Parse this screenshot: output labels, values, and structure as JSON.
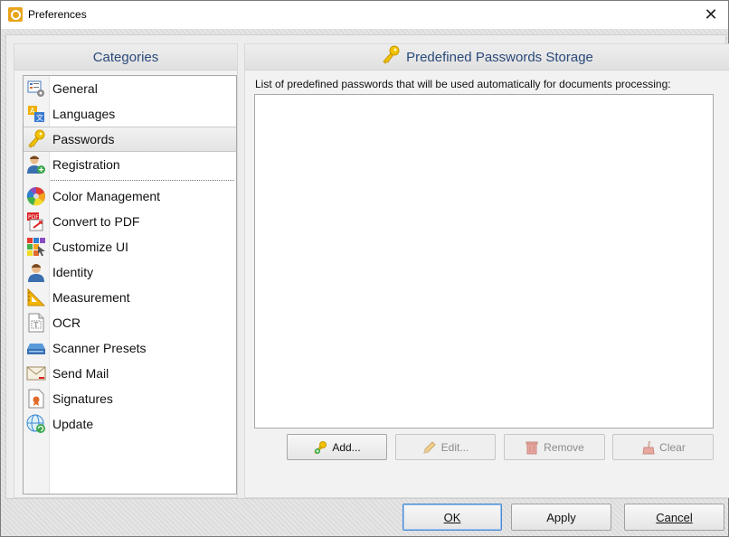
{
  "window": {
    "title": "Preferences",
    "close_glyph": "✕"
  },
  "left_panel": {
    "header": "Categories",
    "items": [
      {
        "label": "General",
        "icon": "general-settings-icon"
      },
      {
        "label": "Languages",
        "icon": "languages-icon"
      },
      {
        "label": "Passwords",
        "icon": "key-icon",
        "selected": true
      },
      {
        "label": "Registration",
        "icon": "user-add-icon"
      },
      {
        "label": "Color Management",
        "icon": "color-wheel-icon"
      },
      {
        "label": "Convert to PDF",
        "icon": "pdf-convert-icon"
      },
      {
        "label": "Customize UI",
        "icon": "customize-ui-icon"
      },
      {
        "label": "Identity",
        "icon": "user-icon"
      },
      {
        "label": "Measurement",
        "icon": "ruler-triangle-icon"
      },
      {
        "label": "OCR",
        "icon": "ocr-icon"
      },
      {
        "label": "Scanner Presets",
        "icon": "scanner-icon"
      },
      {
        "label": "Send Mail",
        "icon": "mail-icon"
      },
      {
        "label": "Signatures",
        "icon": "signature-icon"
      },
      {
        "label": "Update",
        "icon": "globe-update-icon"
      }
    ]
  },
  "right_panel": {
    "header": "Predefined Passwords Storage",
    "description": "List of predefined passwords that will be used automatically for documents processing:",
    "buttons": {
      "add": "Add...",
      "edit": "Edit...",
      "remove": "Remove",
      "clear": "Clear"
    }
  },
  "footer": {
    "ok": "OK",
    "apply": "Apply",
    "cancel": "Cancel"
  },
  "colors": {
    "header_text": "#2a4a7a",
    "accent_key": "#e8b400",
    "default_button_border": "#4a87d0"
  }
}
